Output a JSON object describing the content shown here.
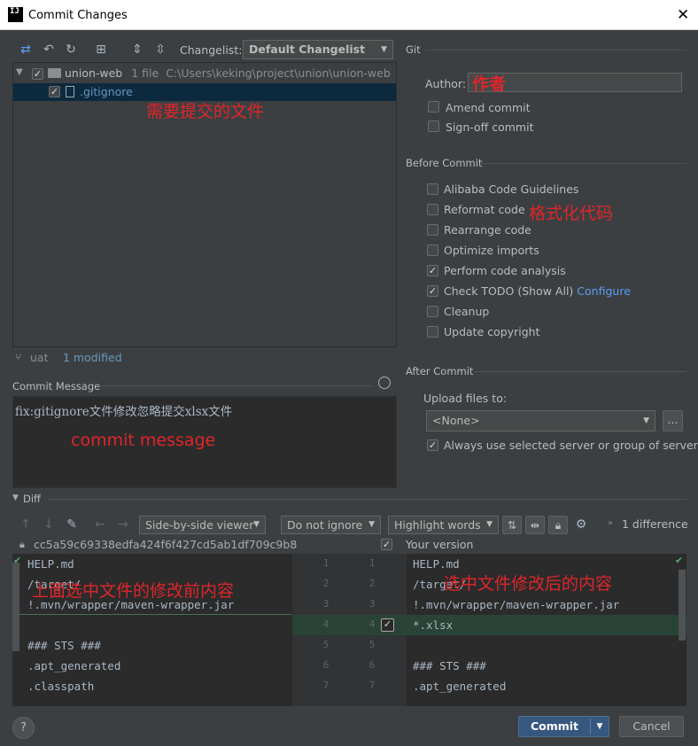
{
  "window": {
    "title": "Commit Changes",
    "logo_text": "IJ"
  },
  "toolbar": {
    "changelist_label": "Changelist:",
    "changelist_value": "Default Changelist"
  },
  "tree": {
    "root": {
      "name": "union-web",
      "count": "1 file",
      "path": "C:\\Users\\keking\\project\\union\\union-web"
    },
    "file": {
      "name": ".gitignore"
    }
  },
  "status": {
    "branch": "uat",
    "modified": "1 modified"
  },
  "git": {
    "section": "Git",
    "author_label": "Author:",
    "author_value": "",
    "amend": "Amend commit",
    "signoff": "Sign-off commit"
  },
  "before_commit": {
    "title": "Before Commit",
    "options": [
      {
        "label": "Alibaba Code Guidelines",
        "checked": false
      },
      {
        "label": "Reformat code",
        "checked": false
      },
      {
        "label": "Rearrange code",
        "checked": false
      },
      {
        "label": "Optimize imports",
        "checked": false
      },
      {
        "label": "Perform code analysis",
        "checked": true
      },
      {
        "label": "Check TODO (Show All)",
        "checked": true,
        "link": "Configure"
      },
      {
        "label": "Cleanup",
        "checked": false
      },
      {
        "label": "Update copyright",
        "checked": false
      }
    ]
  },
  "after_commit": {
    "title": "After Commit",
    "upload_label": "Upload files to:",
    "upload_value": "<None>",
    "more_button": "...",
    "always_label": "Always use selected server or group of servers"
  },
  "commit_message": {
    "label": "Commit Message",
    "text": "fix:gitignore文件修改忽略提交xlsx文件"
  },
  "diff": {
    "title": "Diff",
    "viewer": "Side-by-side viewer",
    "ignore": "Do not ignore",
    "highlight": "Highlight words",
    "difference_count": "1 difference",
    "left_header": "cc5a59c69338edfa424f6f427cd5ab1df709c9b8",
    "right_header": "Your version",
    "left_lines": [
      "HELP.md",
      "/target/",
      "!.mvn/wrapper/maven-wrapper.jar",
      "",
      "### STS ###",
      ".apt_generated",
      ".classpath"
    ],
    "left_numbers": [
      "1",
      "2",
      "3",
      "4",
      "5",
      "6",
      "7"
    ],
    "right_numbers": [
      "1",
      "2",
      "3",
      "4",
      "5",
      "6",
      "7"
    ],
    "right_lines": [
      "HELP.md",
      "/target/",
      "!.mvn/wrapper/maven-wrapper.jar",
      "*.xlsx",
      "",
      "### STS ###",
      ".apt_generated"
    ]
  },
  "annotations": {
    "files": "需要提交的文件",
    "author": "作者",
    "reformat": "格式化代码",
    "message": "commit message",
    "before": "上面选中文件的修改前内容",
    "after": "选中文件修改后的内容"
  },
  "buttons": {
    "commit": "Commit",
    "cancel": "Cancel",
    "help": "?"
  },
  "colors": {
    "bg": "#3c3f41",
    "editor": "#2b2b2b",
    "accent": "#365880",
    "added": "#294436",
    "annotation": "#e0252a",
    "link": "#589df6"
  }
}
